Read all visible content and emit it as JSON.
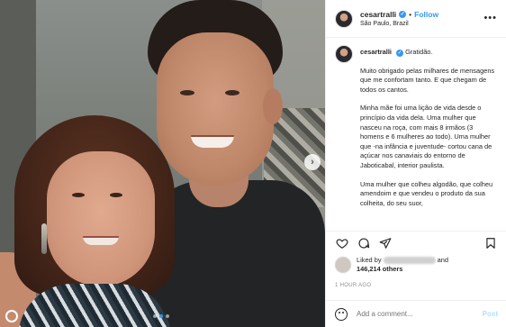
{
  "header": {
    "username": "cesartralli",
    "separator": "•",
    "follow_label": "Follow",
    "location": "São Paulo, Brazil",
    "more_icon": "more-horizontal-icon"
  },
  "caption": {
    "username": "cesartralli",
    "title": "Gratidão.",
    "paragraphs": [
      "Muito obrigado pelas milhares de mensagens que me confortam tanto. E que chegam de todos os cantos.",
      "Minha mãe foi uma lição de vida desde o princípio da vida dela. Uma mulher que nasceu na roça, com mais 8 irmãos (3 homens e 6 mulheres ao todo). Uma mulher que -na infância e juventude- cortou cana de açúcar nos canaviais do entorno de Jaboticabal, interior paulista.",
      "Uma mulher que colheu algodão, que colheu amendoim e que vendeu o produto da sua colheita, do seu suor,"
    ]
  },
  "likes": {
    "prefix": "Liked by",
    "and": "and",
    "count": "146,214 others"
  },
  "time": "1 HOUR AGO",
  "comment": {
    "placeholder": "Add a comment...",
    "post_label": "Post"
  },
  "carousel": {
    "next_glyph": "›",
    "dots": 3,
    "active_index": 1
  },
  "colors": {
    "accent": "#3897f0",
    "post_disabled": "#b2dffc",
    "muted": "#8e8e8e"
  }
}
